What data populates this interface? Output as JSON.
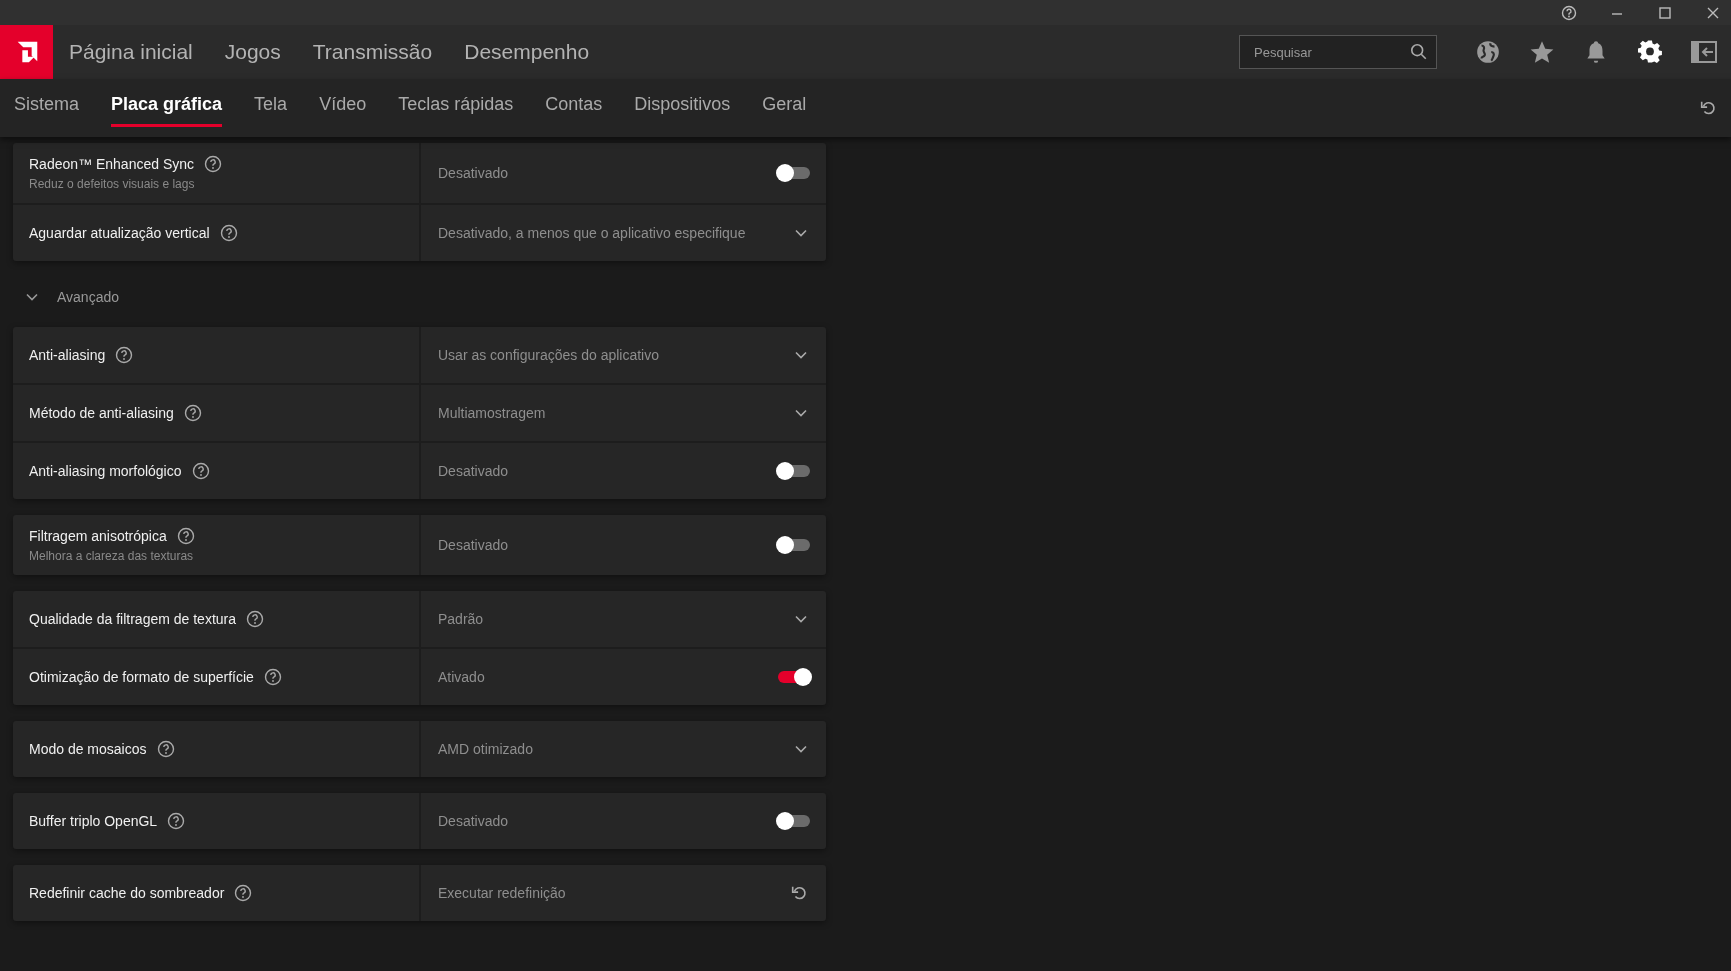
{
  "nav": [
    {
      "label": "Página inicial",
      "selected": false
    },
    {
      "label": "Jogos",
      "selected": false
    },
    {
      "label": "Transmissão",
      "selected": false
    },
    {
      "label": "Desempenho",
      "selected": false
    }
  ],
  "search": {
    "placeholder": "Pesquisar"
  },
  "header_icons": [
    {
      "kind": "globe",
      "selected": false
    },
    {
      "kind": "star",
      "selected": false
    },
    {
      "kind": "bell",
      "selected": false
    },
    {
      "kind": "gear",
      "selected": true
    },
    {
      "kind": "panel",
      "selected": false
    }
  ],
  "tabs": [
    {
      "label": "Sistema",
      "selected": false
    },
    {
      "label": "Placa gráfica",
      "selected": true
    },
    {
      "label": "Tela",
      "selected": false
    },
    {
      "label": "Vídeo",
      "selected": false
    },
    {
      "label": "Teclas rápidas",
      "selected": false
    },
    {
      "label": "Contas",
      "selected": false
    },
    {
      "label": "Dispositivos",
      "selected": false
    },
    {
      "label": "Geral",
      "selected": false
    }
  ],
  "groups": [
    {
      "rows": [
        {
          "kind": "toggle",
          "label": "Radeon™ Enhanced Sync",
          "subtitle": "Reduz o defeitos visuais e lags",
          "value": "Desativado",
          "on": false
        },
        {
          "kind": "dropdown",
          "label": "Aguardar atualização vertical",
          "value": "Desativado, a menos que o aplicativo especifique"
        }
      ]
    },
    {
      "section": {
        "label": "Avançado",
        "expanded": true
      }
    },
    {
      "rows": [
        {
          "kind": "dropdown",
          "label": "Anti-aliasing",
          "value": "Usar as configurações do aplicativo"
        },
        {
          "kind": "dropdown",
          "label": "Método de anti-aliasing",
          "value": "Multiamostragem"
        },
        {
          "kind": "toggle",
          "label": "Anti-aliasing morfológico",
          "value": "Desativado",
          "on": false
        }
      ]
    },
    {
      "rows": [
        {
          "kind": "toggle",
          "label": "Filtragem anisotrópica",
          "subtitle": "Melhora a clareza das texturas",
          "value": "Desativado",
          "on": false
        }
      ]
    },
    {
      "rows": [
        {
          "kind": "dropdown",
          "label": "Qualidade da filtragem de textura",
          "value": "Padrão"
        },
        {
          "kind": "toggle",
          "label": "Otimização de formato de superfície",
          "value": "Ativado",
          "on": true
        }
      ]
    },
    {
      "rows": [
        {
          "kind": "dropdown",
          "label": "Modo de mosaicos",
          "value": "AMD otimizado"
        }
      ]
    },
    {
      "rows": [
        {
          "kind": "toggle",
          "label": "Buffer triplo OpenGL",
          "value": "Desativado",
          "on": false
        }
      ]
    },
    {
      "rows": [
        {
          "kind": "action",
          "label": "Redefinir cache do sombreador",
          "value": "Executar redefinição"
        }
      ]
    }
  ]
}
